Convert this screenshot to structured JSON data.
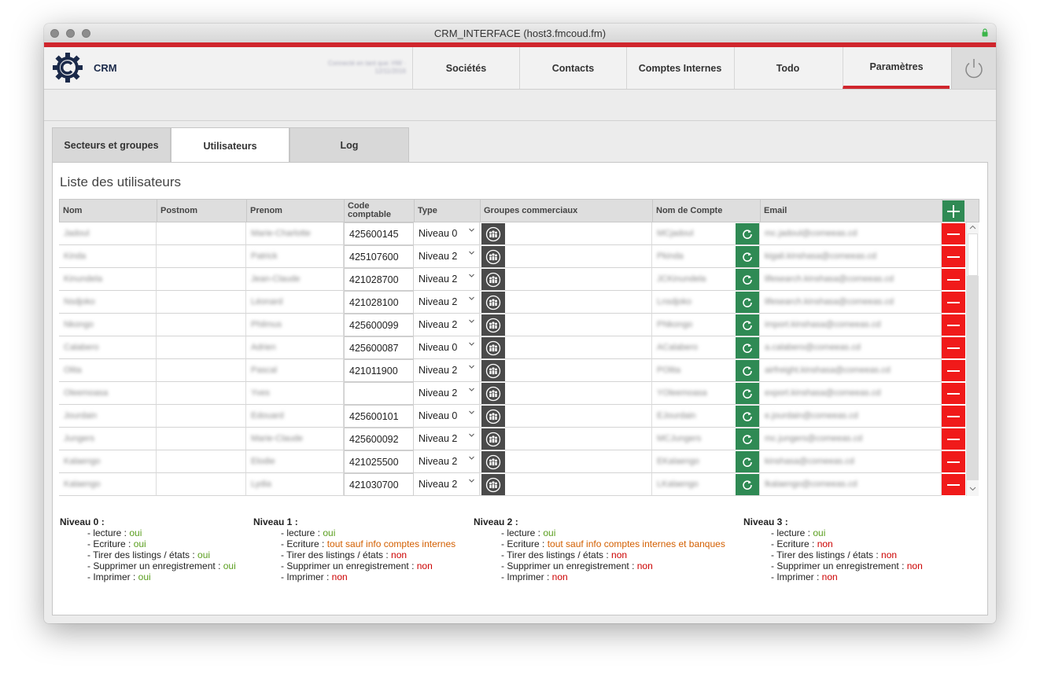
{
  "window": {
    "title": "CRM_INTERFACE (host3.fmcoud.fm)"
  },
  "nav": {
    "brand": "CRM",
    "connection_note": "Connecté en tant que: HW · 12/11/2016",
    "tabs": [
      "Sociétés",
      "Contacts",
      "Comptes Internes",
      "Todo",
      "Paramètres"
    ],
    "active_tab": "Paramètres"
  },
  "subtabs": {
    "items": [
      "Secteurs et groupes",
      "Utilisateurs",
      "Log"
    ],
    "active": "Utilisateurs"
  },
  "panel": {
    "title": "Liste des utilisateurs"
  },
  "table": {
    "headers": {
      "nom": "Nom",
      "postnom": "Postnom",
      "prenom": "Prenom",
      "code_line1": "Code",
      "code_line2": "comptable",
      "type": "Type",
      "groupes": "Groupes commerciaux",
      "compte": "Nom de Compte",
      "email": "Email"
    },
    "rows": [
      {
        "nom": "Jadoul",
        "prenom": "Marie-Charlotte",
        "code": "425600145",
        "type": "Niveau 0",
        "compte": "MCjadoul",
        "email": "mc.jadoul@comeeas.cd"
      },
      {
        "nom": "Kinda",
        "prenom": "Patrick",
        "code": "425107600",
        "type": "Niveau 2",
        "compte": "Pkinda",
        "email": "kigali.kinshasa@comeeas.cd"
      },
      {
        "nom": "Kinundela",
        "prenom": "Jean-Claude",
        "code": "421028700",
        "type": "Niveau 2",
        "compte": "JCKinundela",
        "email": "lifesearch.kinshasa@comeeas.cd"
      },
      {
        "nom": "Nsdjoko",
        "prenom": "Léonard",
        "code": "421028100",
        "type": "Niveau 2",
        "compte": "Lnsdjoko",
        "email": "lifesearch.kinshasa@comeeas.cd"
      },
      {
        "nom": "Nkongo",
        "prenom": "Philmus",
        "code": "425600099",
        "type": "Niveau 2",
        "compte": "PNkongo",
        "email": "import.kinshasa@comeeas.cd"
      },
      {
        "nom": "Calabero",
        "prenom": "Adrien",
        "code": "425600087",
        "type": "Niveau 0",
        "compte": "ACalabero",
        "email": "a.calabero@comeeas.cd"
      },
      {
        "nom": "Olita",
        "prenom": "Pascal",
        "code": "421011900",
        "type": "Niveau 2",
        "compte": "POlita",
        "email": "airfreight.kinshasa@comeeas.cd"
      },
      {
        "nom": "Oleemoasa",
        "prenom": "Yves",
        "code": "",
        "type": "Niveau 2",
        "compte": "YOleemoasa",
        "email": "export.kinshasa@comeeas.cd"
      },
      {
        "nom": "Jourdain",
        "prenom": "Edouard",
        "code": "425600101",
        "type": "Niveau 0",
        "compte": "EJourdain",
        "email": "e.jourdain@comeeas.cd"
      },
      {
        "nom": "Jungers",
        "prenom": "Marie-Claude",
        "code": "425600092",
        "type": "Niveau 2",
        "compte": "MCJungers",
        "email": "mc.jungers@comeeas.cd"
      },
      {
        "nom": "Kalaengo",
        "prenom": "Elodie",
        "code": "421025500",
        "type": "Niveau 2",
        "compte": "EKalaengo",
        "email": "kinshasa@comeeas.cd"
      },
      {
        "nom": "Kalaengo",
        "prenom": "Lydia",
        "code": "421030700",
        "type": "Niveau 2",
        "compte": "LKalaengo",
        "email": "lkalaengo@comeeas.cd"
      }
    ]
  },
  "legend": [
    {
      "title": "Niveau 0 :",
      "items": [
        {
          "label": "- lecture : ",
          "value": "oui",
          "status": "oui"
        },
        {
          "label": "- Ecriture : ",
          "value": "oui",
          "status": "oui"
        },
        {
          "label": "- Tirer des listings / états : ",
          "value": "oui",
          "status": "oui"
        },
        {
          "label": "- Supprimer un enregistrement : ",
          "value": "oui",
          "status": "oui"
        },
        {
          "label": "- Imprimer : ",
          "value": "oui",
          "status": "oui"
        }
      ]
    },
    {
      "title": "Niveau 1 :",
      "items": [
        {
          "label": "- lecture : ",
          "value": "oui",
          "status": "oui"
        },
        {
          "label": "- Ecriture : ",
          "value": "tout sauf info comptes internes",
          "status": "partial"
        },
        {
          "label": "- Tirer des listings / états : ",
          "value": "non",
          "status": "non"
        },
        {
          "label": "- Supprimer un enregistrement : ",
          "value": "non",
          "status": "non"
        },
        {
          "label": "- Imprimer : ",
          "value": "non",
          "status": "non"
        }
      ]
    },
    {
      "title": "Niveau 2 :",
      "items": [
        {
          "label": "- lecture : ",
          "value": "oui",
          "status": "oui"
        },
        {
          "label": "- Ecriture : ",
          "value": "tout sauf info comptes internes et banques",
          "status": "partial"
        },
        {
          "label": "- Tirer des listings / états : ",
          "value": "non",
          "status": "non"
        },
        {
          "label": "- Supprimer un enregistrement : ",
          "value": "non",
          "status": "non"
        },
        {
          "label": "- Imprimer : ",
          "value": "non",
          "status": "non"
        }
      ]
    },
    {
      "title": "Niveau 3 :",
      "items": [
        {
          "label": "- lecture : ",
          "value": "oui",
          "status": "oui"
        },
        {
          "label": "- Ecriture : ",
          "value": "non",
          "status": "non"
        },
        {
          "label": "- Tirer des listings / états : ",
          "value": "non",
          "status": "non"
        },
        {
          "label": "- Supprimer un enregistrement : ",
          "value": "non",
          "status": "non"
        },
        {
          "label": "- Imprimer : ",
          "value": "non",
          "status": "non"
        }
      ]
    }
  ],
  "colors": {
    "accent_red": "#d0262d",
    "add_green": "#2f8a54",
    "delete_red": "#f01a1a",
    "yes_green": "#5a9e1e",
    "no_red": "#cc0000",
    "partial_orange": "#d35f00"
  },
  "icons": {
    "logo": "gear-c-logo-icon",
    "power": "power-icon",
    "add": "plus-icon",
    "delete": "minus-icon",
    "refresh": "refresh-icon",
    "groups": "people-group-icon",
    "chevron": "chevron-down-icon",
    "lock": "lock-icon"
  }
}
